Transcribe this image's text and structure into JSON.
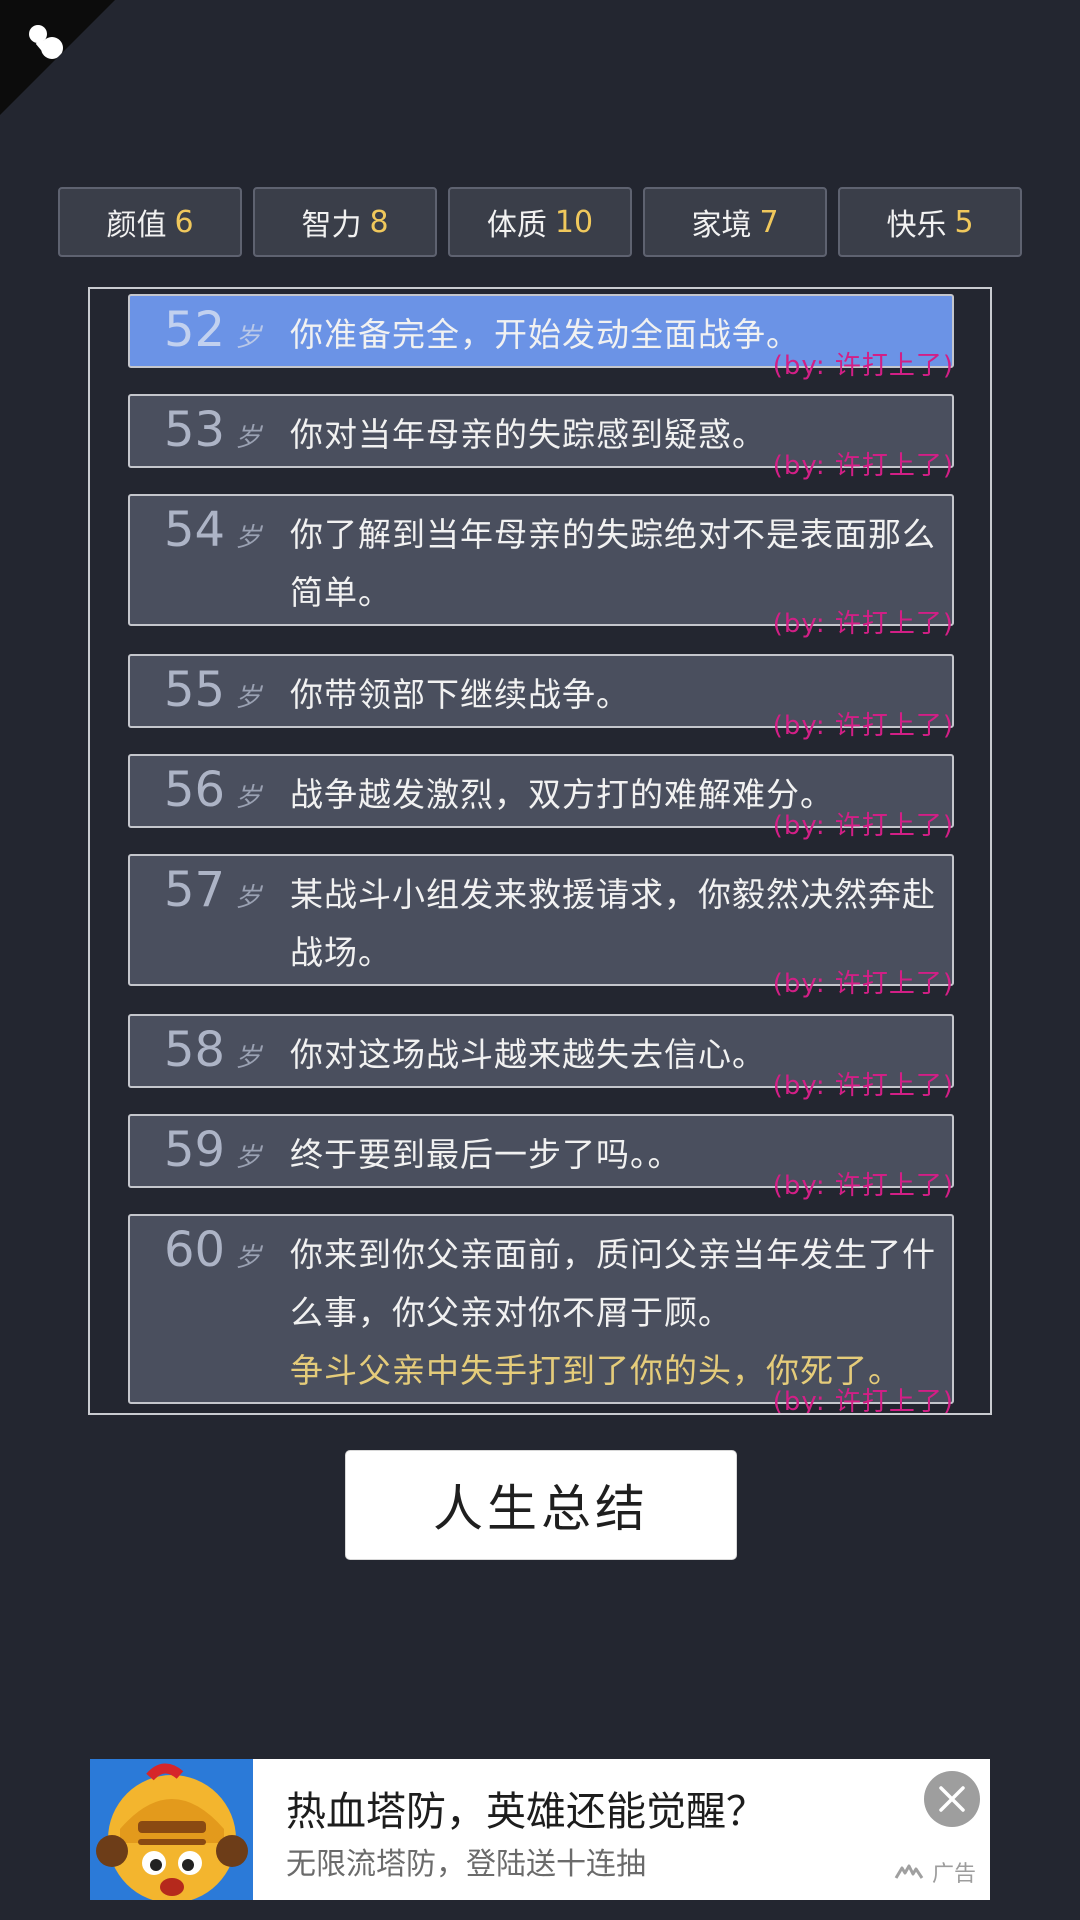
{
  "attributes": [
    {
      "label": "颜值",
      "value": "6"
    },
    {
      "label": "智力",
      "value": "8"
    },
    {
      "label": "体质",
      "value": "10"
    },
    {
      "label": "家境",
      "value": "7"
    },
    {
      "label": "快乐",
      "value": "5"
    }
  ],
  "age_unit": "岁",
  "author_tag": "(by: 许打上了)",
  "events": [
    {
      "age": "52",
      "text": "你准备完全，开始发动全面战争。",
      "active": true
    },
    {
      "age": "53",
      "text": "你对当年母亲的失踪感到疑惑。"
    },
    {
      "age": "54",
      "text": "你了解到当年母亲的失踪绝对不是表面那么简单。"
    },
    {
      "age": "55",
      "text": "你带领部下继续战争。"
    },
    {
      "age": "56",
      "text": "战争越发激烈，双方打的难解难分。"
    },
    {
      "age": "57",
      "text": "某战斗小组发来救援请求，你毅然决然奔赴战场。"
    },
    {
      "age": "58",
      "text": "你对这场战斗越来越失去信心。"
    },
    {
      "age": "59",
      "text": "终于要到最后一步了吗。。"
    },
    {
      "age": "60",
      "text": "你来到你父亲面前，质问父亲当年发生了什么事，你父亲对你不屑于顾。",
      "death": "争斗父亲中失手打到了你的头，你死了。"
    }
  ],
  "summary_button": "人生总结",
  "ad": {
    "title": "热血塔防，英雄还能觉醒？",
    "subtitle": "无限流塔防，登陆送十连抽",
    "tag": "广告"
  },
  "icons": {
    "corner": "menu-corner-icon",
    "close": "close-icon",
    "ad_logo": "ad-network-icon"
  },
  "colors": {
    "background": "#232630",
    "stat_value": "#f0c85c",
    "active_event": "#6b93e6",
    "author_tag": "#d21f86",
    "death_text": "#e5cc7a"
  }
}
